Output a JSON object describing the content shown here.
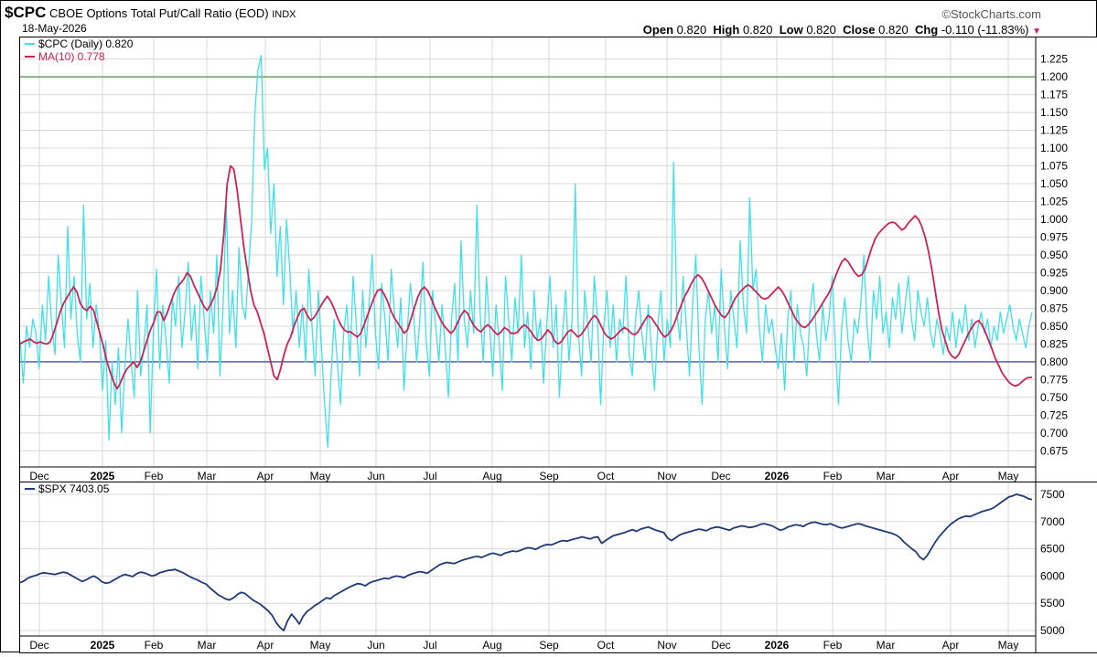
{
  "header": {
    "symbol": "$CPC",
    "name": "CBOE Options Total Put/Call Ratio (EOD)",
    "exchange": "INDX",
    "date": "18-May-2026",
    "brand": "©StockCharts.com",
    "open_label": "Open",
    "open": "0.820",
    "high_label": "High",
    "high": "0.820",
    "low_label": "Low",
    "low": "0.820",
    "close_label": "Close",
    "close": "0.820",
    "chg_label": "Chg",
    "chg": "-0.110 (-11.83%)"
  },
  "colors": {
    "cpc": "#40e0e8",
    "ma": "#cc2255",
    "spx": "#1f3a78",
    "level_high": "#2e8b2e",
    "level_low": "#1c2a80",
    "grid": "#d8d8d8"
  },
  "chart_data": [
    {
      "type": "line",
      "legend": [
        {
          "label": "$CPC (Daily) 0.820",
          "color": "#40e0e8"
        },
        {
          "label": "MA(10) 0.778",
          "color": "#cc2255"
        }
      ],
      "x_tick_labels": [
        "Dec",
        "2025",
        "Feb",
        "Mar",
        "Apr",
        "May",
        "Jun",
        "Jul",
        "Aug",
        "Sep",
        "Oct",
        "Nov",
        "Dec",
        "2026",
        "Feb",
        "Mar",
        "Apr",
        "May"
      ],
      "y_tick_labels": [
        "1.225",
        "1.200",
        "1.175",
        "1.150",
        "1.125",
        "1.100",
        "1.075",
        "1.050",
        "1.025",
        "1.000",
        "0.975",
        "0.950",
        "0.925",
        "0.900",
        "0.875",
        "0.850",
        "0.825",
        "0.800",
        "0.775",
        "0.750",
        "0.725",
        "0.700",
        "0.675"
      ],
      "ylim": [
        0.655,
        1.245
      ],
      "horizontal_lines": [
        1.2,
        0.8
      ],
      "grid": true,
      "series": [
        {
          "name": "$CPC (Daily)",
          "values": [
            0.83,
            0.77,
            0.85,
            0.82,
            0.86,
            0.84,
            0.79,
            0.88,
            0.83,
            0.92,
            0.85,
            0.81,
            0.95,
            0.88,
            0.82,
            0.99,
            0.86,
            0.92,
            0.84,
            0.8,
            1.02,
            0.86,
            0.91,
            0.82,
            0.88,
            0.84,
            0.76,
            0.83,
            0.69,
            0.8,
            0.74,
            0.82,
            0.7,
            0.79,
            0.86,
            0.8,
            0.75,
            0.9,
            0.78,
            0.82,
            0.88,
            0.7,
            0.84,
            0.93,
            0.79,
            0.88,
            0.83,
            0.77,
            0.89,
            0.85,
            0.92,
            0.82,
            0.87,
            0.94,
            0.83,
            0.88,
            0.79,
            0.92,
            0.86,
            0.8,
            0.9,
            0.84,
            0.95,
            0.78,
            0.88,
            1.02,
            0.84,
            0.9,
            0.82,
            0.96,
            0.88,
            0.86,
            0.93,
            1.0,
            1.15,
            1.21,
            1.23,
            1.07,
            1.1,
            0.98,
            1.05,
            0.92,
            0.99,
            0.88,
            1.0,
            0.93,
            0.84,
            0.9,
            0.82,
            0.88,
            0.8,
            0.93,
            0.85,
            0.78,
            0.9,
            0.82,
            0.74,
            0.68,
            0.78,
            0.86,
            0.8,
            0.74,
            0.84,
            0.88,
            0.8,
            0.92,
            0.85,
            0.78,
            0.9,
            0.82,
            0.88,
            0.95,
            0.84,
            0.79,
            0.91,
            0.86,
            0.8,
            0.93,
            0.87,
            0.82,
            0.89,
            0.76,
            0.84,
            0.91,
            0.87,
            0.8,
            0.86,
            0.94,
            0.83,
            0.78,
            0.9,
            0.85,
            0.8,
            0.88,
            0.82,
            0.75,
            0.86,
            0.91,
            0.8,
            0.97,
            0.86,
            0.82,
            0.9,
            0.84,
            1.02,
            0.87,
            0.8,
            0.92,
            0.85,
            0.78,
            0.88,
            0.83,
            0.76,
            0.92,
            0.86,
            0.8,
            0.89,
            0.84,
            0.95,
            0.82,
            0.87,
            0.79,
            0.9,
            0.83,
            0.86,
            0.77,
            0.85,
            0.92,
            0.82,
            0.88,
            0.75,
            0.84,
            0.9,
            0.8,
            0.86,
            1.05,
            0.84,
            0.78,
            0.9,
            0.85,
            0.8,
            0.92,
            0.86,
            0.74,
            0.85,
            0.9,
            0.82,
            0.88,
            0.8,
            0.86,
            0.84,
            0.92,
            0.81,
            0.78,
            0.86,
            0.9,
            0.84,
            0.8,
            0.88,
            0.82,
            0.76,
            0.85,
            0.9,
            0.8,
            0.86,
            0.82,
            1.08,
            0.87,
            0.83,
            0.92,
            0.85,
            0.78,
            0.88,
            0.95,
            0.82,
            0.74,
            0.86,
            0.9,
            0.84,
            0.88,
            0.8,
            0.93,
            0.85,
            0.79,
            0.9,
            0.86,
            0.82,
            0.97,
            0.88,
            0.84,
            1.03,
            0.9,
            0.93,
            0.85,
            0.8,
            0.88,
            0.84,
            0.86,
            0.82,
            0.79,
            0.84,
            0.76,
            0.86,
            0.9,
            0.8,
            0.88,
            0.84,
            0.82,
            0.78,
            0.87,
            0.91,
            0.84,
            0.8,
            0.88,
            0.83,
            0.86,
            0.92,
            0.82,
            0.74,
            0.85,
            0.89,
            0.83,
            0.8,
            0.86,
            0.84,
            0.88,
            0.95,
            0.85,
            0.8,
            0.9,
            0.86,
            0.92,
            0.84,
            0.87,
            0.82,
            0.89,
            0.86,
            0.91,
            0.84,
            0.88,
            0.92,
            0.86,
            0.83,
            0.9,
            0.87,
            0.85,
            0.89,
            0.84,
            0.82,
            0.86,
            0.84,
            0.81,
            0.85,
            0.83,
            0.87,
            0.82,
            0.86,
            0.84,
            0.88,
            0.83,
            0.86,
            0.82,
            0.85,
            0.87,
            0.84,
            0.86,
            0.82,
            0.85,
            0.83,
            0.87,
            0.84,
            0.86,
            0.88,
            0.85,
            0.83,
            0.86,
            0.84,
            0.82,
            0.85,
            0.87
          ],
          "color": "#40e0e8"
        },
        {
          "name": "MA(10)",
          "values": [
            0.825,
            0.828,
            0.83,
            0.832,
            0.828,
            0.826,
            0.828,
            0.826,
            0.825,
            0.828,
            0.84,
            0.855,
            0.87,
            0.882,
            0.89,
            0.898,
            0.905,
            0.898,
            0.882,
            0.875,
            0.872,
            0.878,
            0.872,
            0.855,
            0.838,
            0.82,
            0.8,
            0.785,
            0.772,
            0.762,
            0.77,
            0.782,
            0.79,
            0.795,
            0.8,
            0.792,
            0.8,
            0.815,
            0.83,
            0.845,
            0.855,
            0.87,
            0.87,
            0.858,
            0.868,
            0.882,
            0.895,
            0.905,
            0.91,
            0.916,
            0.925,
            0.92,
            0.908,
            0.898,
            0.888,
            0.878,
            0.872,
            0.88,
            0.89,
            0.905,
            0.93,
            0.98,
            1.05,
            1.075,
            1.07,
            1.04,
            1.0,
            0.96,
            0.93,
            0.9,
            0.88,
            0.87,
            0.855,
            0.84,
            0.82,
            0.8,
            0.78,
            0.775,
            0.79,
            0.81,
            0.825,
            0.835,
            0.85,
            0.862,
            0.872,
            0.875,
            0.865,
            0.858,
            0.862,
            0.87,
            0.878,
            0.886,
            0.892,
            0.885,
            0.875,
            0.862,
            0.852,
            0.845,
            0.842,
            0.842,
            0.838,
            0.835,
            0.84,
            0.852,
            0.865,
            0.878,
            0.89,
            0.9,
            0.902,
            0.895,
            0.885,
            0.872,
            0.862,
            0.855,
            0.848,
            0.84,
            0.845,
            0.86,
            0.875,
            0.89,
            0.9,
            0.905,
            0.9,
            0.89,
            0.878,
            0.868,
            0.858,
            0.85,
            0.845,
            0.84,
            0.845,
            0.855,
            0.865,
            0.872,
            0.868,
            0.858,
            0.85,
            0.845,
            0.842,
            0.848,
            0.852,
            0.848,
            0.842,
            0.838,
            0.842,
            0.848,
            0.845,
            0.84,
            0.84,
            0.842,
            0.848,
            0.852,
            0.848,
            0.842,
            0.835,
            0.83,
            0.832,
            0.838,
            0.845,
            0.84,
            0.83,
            0.825,
            0.828,
            0.835,
            0.842,
            0.845,
            0.84,
            0.835,
            0.838,
            0.845,
            0.852,
            0.86,
            0.865,
            0.86,
            0.85,
            0.84,
            0.835,
            0.832,
            0.835,
            0.84,
            0.845,
            0.848,
            0.845,
            0.84,
            0.838,
            0.842,
            0.85,
            0.858,
            0.865,
            0.862,
            0.855,
            0.848,
            0.84,
            0.835,
            0.838,
            0.845,
            0.855,
            0.868,
            0.88,
            0.892,
            0.9,
            0.91,
            0.918,
            0.922,
            0.918,
            0.91,
            0.9,
            0.89,
            0.88,
            0.872,
            0.865,
            0.862,
            0.868,
            0.878,
            0.888,
            0.895,
            0.9,
            0.905,
            0.908,
            0.905,
            0.9,
            0.895,
            0.89,
            0.888,
            0.89,
            0.895,
            0.9,
            0.905,
            0.9,
            0.892,
            0.882,
            0.872,
            0.862,
            0.855,
            0.85,
            0.848,
            0.852,
            0.858,
            0.865,
            0.872,
            0.88,
            0.888,
            0.895,
            0.905,
            0.918,
            0.93,
            0.94,
            0.945,
            0.94,
            0.932,
            0.925,
            0.92,
            0.922,
            0.93,
            0.945,
            0.96,
            0.972,
            0.98,
            0.985,
            0.99,
            0.994,
            0.996,
            0.995,
            0.99,
            0.985,
            0.988,
            0.995,
            1.0,
            1.005,
            1.0,
            0.99,
            0.975,
            0.955,
            0.93,
            0.9,
            0.87,
            0.845,
            0.83,
            0.815,
            0.808,
            0.805,
            0.81,
            0.82,
            0.83,
            0.84,
            0.848,
            0.855,
            0.858,
            0.852,
            0.842,
            0.83,
            0.818,
            0.805,
            0.795,
            0.785,
            0.778,
            0.772,
            0.768,
            0.766,
            0.768,
            0.772,
            0.776,
            0.778,
            0.778
          ],
          "color": "#cc2255"
        }
      ]
    },
    {
      "type": "line",
      "legend": [
        {
          "label": "$SPX 7403.05",
          "color": "#1f3a78"
        }
      ],
      "x_tick_labels": [
        "Dec",
        "2025",
        "Feb",
        "Mar",
        "Apr",
        "May",
        "Jun",
        "Jul",
        "Aug",
        "Sep",
        "Oct",
        "Nov",
        "Dec",
        "2026",
        "Feb",
        "Mar",
        "Apr",
        "May"
      ],
      "y_tick_labels": [
        "7500",
        "7000",
        "6500",
        "6000",
        "5500",
        "5000"
      ],
      "ylim": [
        4900,
        7650
      ],
      "grid": true,
      "series": [
        {
          "name": "$SPX",
          "values": [
            5880,
            5910,
            5960,
            5990,
            6010,
            6040,
            6060,
            6050,
            6040,
            6030,
            6050,
            6070,
            6060,
            6020,
            5980,
            5940,
            5900,
            5930,
            5970,
            6000,
            5960,
            5900,
            5870,
            5880,
            5920,
            5960,
            6000,
            6030,
            6010,
            5990,
            6040,
            6070,
            6060,
            6030,
            6000,
            6020,
            6060,
            6080,
            6100,
            6110,
            6120,
            6090,
            6060,
            6020,
            5980,
            5950,
            5920,
            5880,
            5850,
            5780,
            5720,
            5660,
            5620,
            5580,
            5560,
            5600,
            5660,
            5700,
            5680,
            5620,
            5560,
            5520,
            5480,
            5420,
            5360,
            5280,
            5150,
            5060,
            5000,
            5180,
            5300,
            5220,
            5120,
            5260,
            5350,
            5400,
            5460,
            5500,
            5550,
            5600,
            5580,
            5640,
            5680,
            5720,
            5760,
            5800,
            5830,
            5860,
            5850,
            5820,
            5870,
            5900,
            5920,
            5940,
            5960,
            5950,
            5980,
            6000,
            5990,
            5970,
            6010,
            6040,
            6060,
            6080,
            6070,
            6050,
            6100,
            6150,
            6200,
            6230,
            6250,
            6240,
            6230,
            6260,
            6290,
            6310,
            6330,
            6350,
            6360,
            6340,
            6370,
            6400,
            6420,
            6400,
            6380,
            6420,
            6440,
            6460,
            6450,
            6470,
            6500,
            6520,
            6510,
            6490,
            6530,
            6560,
            6580,
            6570,
            6600,
            6630,
            6650,
            6640,
            6660,
            6680,
            6700,
            6720,
            6700,
            6680,
            6710,
            6720,
            6600,
            6650,
            6700,
            6740,
            6760,
            6780,
            6800,
            6830,
            6850,
            6820,
            6860,
            6880,
            6900,
            6870,
            6840,
            6820,
            6800,
            6700,
            6650,
            6700,
            6750,
            6780,
            6800,
            6820,
            6840,
            6860,
            6850,
            6830,
            6870,
            6890,
            6900,
            6880,
            6860,
            6840,
            6880,
            6900,
            6920,
            6910,
            6890,
            6900,
            6920,
            6950,
            6960,
            6940,
            6920,
            6880,
            6840,
            6860,
            6900,
            6920,
            6940,
            6930,
            6910,
            6950,
            6980,
            6990,
            6970,
            6950,
            6940,
            6960,
            6930,
            6900,
            6880,
            6900,
            6920,
            6940,
            6960,
            6950,
            6920,
            6900,
            6880,
            6860,
            6840,
            6820,
            6800,
            6780,
            6750,
            6700,
            6620,
            6560,
            6500,
            6450,
            6350,
            6300,
            6380,
            6500,
            6620,
            6720,
            6800,
            6880,
            6950,
            7000,
            7050,
            7080,
            7100,
            7090,
            7120,
            7150,
            7180,
            7200,
            7220,
            7250,
            7300,
            7350,
            7400,
            7450,
            7470,
            7500,
            7480,
            7460,
            7420,
            7403
          ],
          "color": "#1f3a78"
        }
      ]
    }
  ]
}
